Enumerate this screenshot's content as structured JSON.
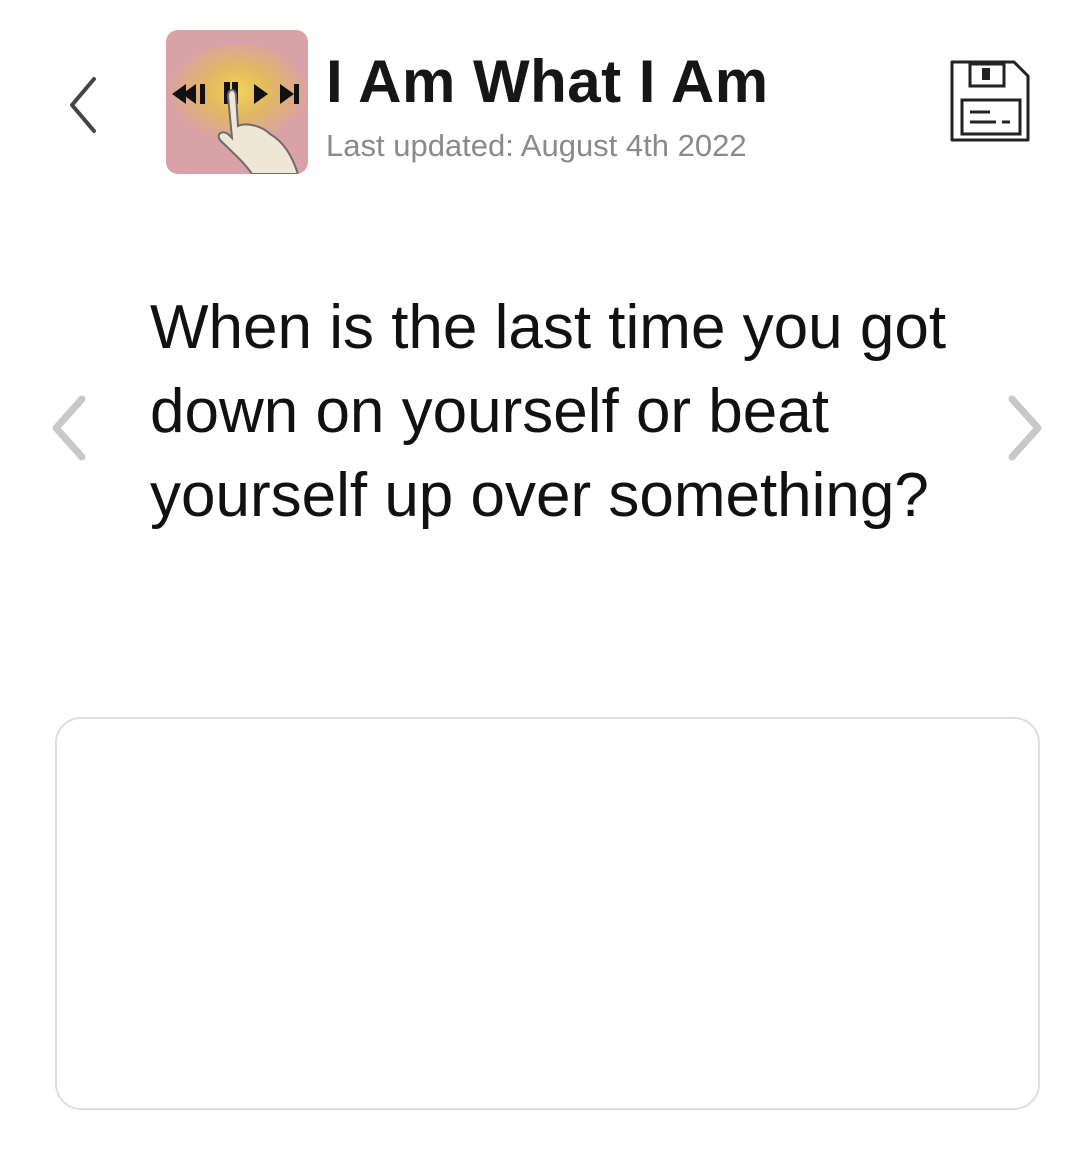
{
  "header": {
    "title": "I Am What I Am",
    "subtitle": "Last updated: August 4th 2022",
    "back_icon": "chevron-left-icon",
    "save_icon": "floppy-disk-save-icon",
    "thumbnail_icon": "media-controls-hand-thumbnail"
  },
  "prompt": {
    "question": "When is the last time you got down on yourself or beat yourself up over something?",
    "prev_icon": "chevron-left-icon",
    "next_icon": "chevron-right-icon"
  },
  "answer": {
    "value": "",
    "placeholder": ""
  },
  "colors": {
    "text": "#111111",
    "subtitle": "#8a8a8a",
    "arrow_disabled": "#c8c8c8",
    "border": "#dedede",
    "thumb_bg": "#d9a2a6",
    "thumb_glow": "#e8c14a"
  }
}
